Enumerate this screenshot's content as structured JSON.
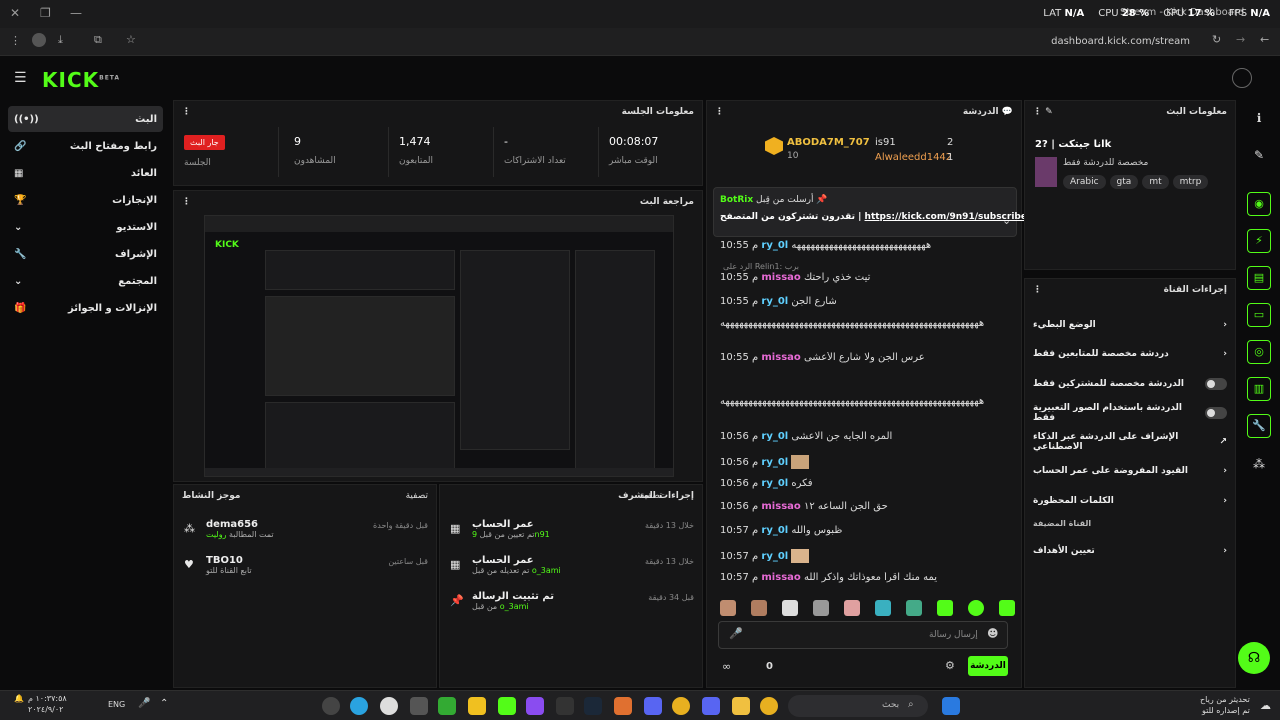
{
  "window": {
    "tab_title": "Stream - Kick Dashboard",
    "perf": {
      "fps_label": "FPS",
      "fps": "N/A",
      "gpu_label": "GPU",
      "gpu": "17 %",
      "cpu_label": "CPU",
      "cpu": "28 %",
      "lat_label": "LAT",
      "lat": "N/A"
    }
  },
  "browser": {
    "url": "dashboard.kick.com/stream"
  },
  "app": {
    "logo": "KICK",
    "logo_sup": "BETA"
  },
  "sidebar": {
    "items": [
      {
        "label": "البث"
      },
      {
        "label": "رابط ومفتاح البث"
      },
      {
        "label": "العائد"
      },
      {
        "label": "الإنجازات"
      },
      {
        "label": "الاستديو"
      },
      {
        "label": "الإشراف"
      },
      {
        "label": "المجتمع"
      },
      {
        "label": "الإنزالات و الجوائز"
      }
    ]
  },
  "session": {
    "title": "معلومات الجلسة",
    "stats": [
      {
        "value": "00:08:07",
        "label": "الوقت مباشر"
      },
      {
        "value": "-",
        "label": "تعداد الاشتراكات"
      },
      {
        "value": "1,474",
        "label": "المتابعون"
      },
      {
        "value": "9",
        "label": "المشاهدون"
      },
      {
        "value": "جار البث",
        "label": "الجلسة"
      }
    ]
  },
  "preview": {
    "title": "مراجعة البث"
  },
  "activity": {
    "title": "موجز النشاط",
    "filter": "تصفية",
    "items": [
      {
        "name": "dema656",
        "sub": "تمت المطالبة",
        "sub2": "روليت",
        "time": "قبل دقيقة واحدة"
      },
      {
        "name": "TBO10",
        "sub": "تابع القناة للتو",
        "time": "قبل ساعتين"
      }
    ]
  },
  "modactions": {
    "title": "إجراءات المشرف",
    "filter": "تصفية",
    "items": [
      {
        "title": "عمر الحساب",
        "sub": "تم تعيين من قبل",
        "user": "9n91",
        "time": "خلال 13 دقيقة"
      },
      {
        "title": "عمر الحساب",
        "sub": "تم تعديله من قبل",
        "user": "o_3ami",
        "time": "خلال 13 دقيقة"
      },
      {
        "title": "تم تثبيت الرسالة",
        "sub": "من قبل",
        "user": "o_3ami",
        "time": "قبل 34 دقيقة"
      }
    ]
  },
  "chat": {
    "title": "الدردشة",
    "leaders": [
      {
        "name": "ABODA7M_707",
        "count": "10"
      },
      {
        "name": "is91",
        "count": "2"
      },
      {
        "name": "Alwaleedd1442",
        "count": "1"
      }
    ],
    "pinned": {
      "label": "أرسلت من قِبل",
      "by": "BotRix",
      "text": "تقدرون تشتركون من المتصفح |",
      "link": "https://kick.com/9n91/subscribe"
    },
    "reply_note": "الرد على Relin1: برب",
    "messages": [
      {
        "time": "10:55 م",
        "user": "ry_0l",
        "text": "هههههههههههههههههههههههههههههه"
      },
      {
        "time": "10:55 م",
        "user": "missao",
        "text": "تيت خذي راحتك"
      },
      {
        "time": "10:55 م",
        "user": "ry_0l",
        "text": "شارع الجن"
      },
      {
        "time": "",
        "user": "",
        "text": "ههههههههههههههههههههههههههههههههههههههههههههههههههههههههه"
      },
      {
        "time": "10:55 م",
        "user": "missao",
        "text": "عرس الجن ولا شارع الأعشى"
      },
      {
        "time": "",
        "user": "",
        "text": "ههههههههههههههههههههههههههههههههههههههههههههههههههههههههه"
      },
      {
        "time": "10:56 م",
        "user": "ry_0l",
        "text": "المره الجايه جن الاعشى"
      },
      {
        "time": "10:56 م",
        "user": "ry_0l",
        "text": ""
      },
      {
        "time": "10:56 م",
        "user": "ry_0l",
        "text": "فكره"
      },
      {
        "time": "10:56 م",
        "user": "missao",
        "text": "حق الجن الساعه ١٢"
      },
      {
        "time": "10:57 م",
        "user": "ry_0l",
        "text": "ظبوس والله"
      },
      {
        "time": "10:57 م",
        "user": "ry_0l",
        "text": ""
      },
      {
        "time": "10:57 م",
        "user": "missao",
        "text": "يمه منك اقرأ معوذاتك واذكر الله"
      }
    ],
    "input_placeholder": "إرسال رسالة",
    "send_label": "الدردشة",
    "viewer_count": "0"
  },
  "stream_info": {
    "title": "معلومات البث",
    "stream_title": "انا جيتكت | ?2k",
    "category": "مخصصة للدردشة فقط",
    "tags": [
      "mtrp",
      "mt",
      "gta",
      "Arabic"
    ]
  },
  "channel_actions": {
    "title": "إجراءات القناة",
    "rows": [
      {
        "label": "الوضع البطيء",
        "kind": "chevron"
      },
      {
        "label": "دردشة مخصصة للمتابعين فقط",
        "kind": "chevron"
      },
      {
        "label": "الدردشة مخصصة للمشتركين فقط",
        "kind": "toggle"
      },
      {
        "label": "الدردشة باستخدام الصور التعبيرية فقط",
        "kind": "toggle"
      },
      {
        "label": "الإشراف على الدردشة عبر الذكاء الاصطناعي",
        "kind": "external"
      },
      {
        "label": "القيود المفروضة على عمر الحساب",
        "kind": "chevron"
      },
      {
        "label": "الكلمات المحظورة",
        "kind": "chevron"
      }
    ],
    "hosting_title": "القناة المضيفة",
    "hosting_row": "تعيين الأهداف"
  },
  "taskbar": {
    "clock": "١٠:٣٧:٥٨ م",
    "date": "٢٠٢٤/٩/٠٢",
    "lang": "ENG",
    "search": "بحث",
    "update_line1": "تحديثر من رياح",
    "update_line2": "تم إصداره للتو"
  }
}
